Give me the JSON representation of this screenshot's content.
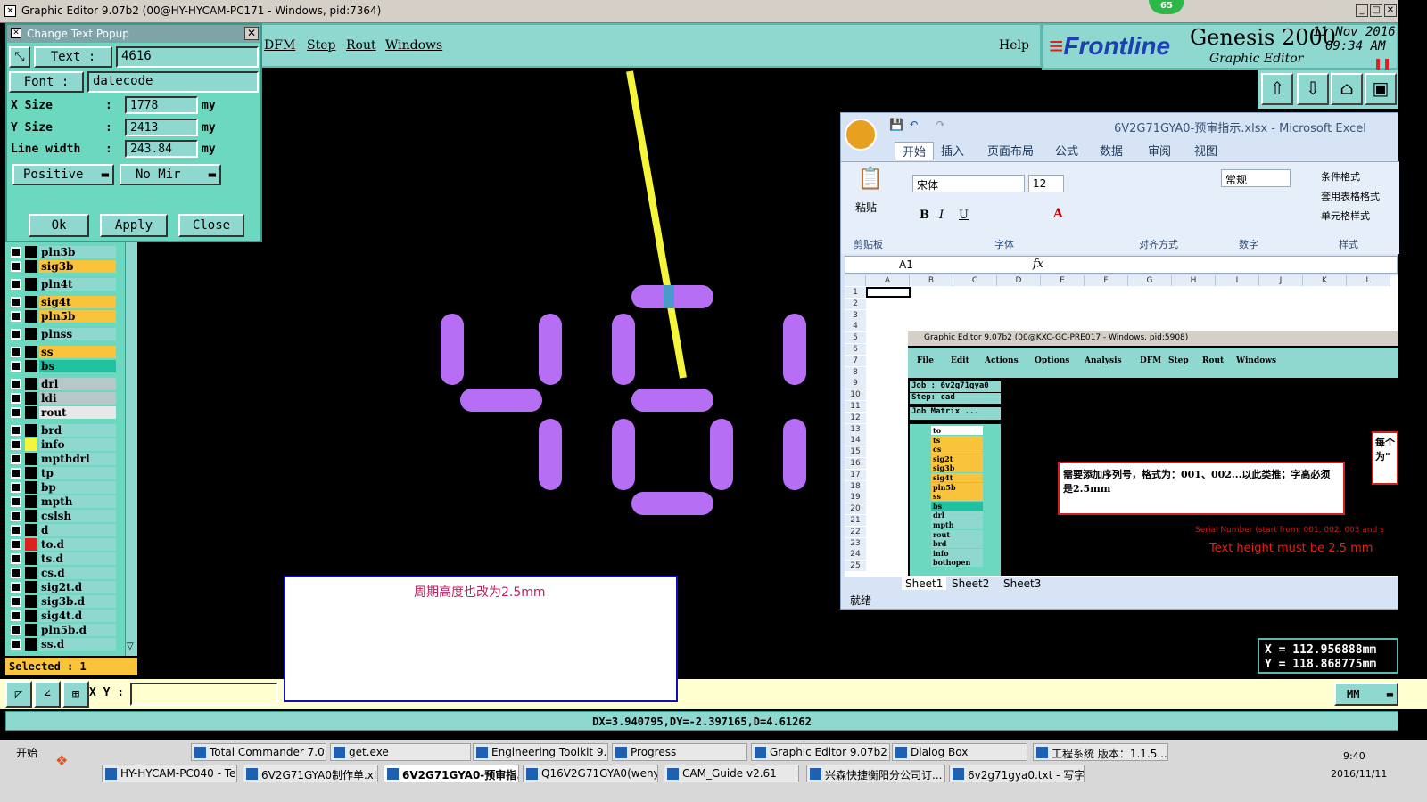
{
  "app": {
    "title": "Graphic Editor 9.07b2 (00@HY-HYCAM-PC171 - Windows, pid:7364)",
    "notif_badge": "65"
  },
  "menu": {
    "items": [
      "DFM",
      "Step",
      "Rout",
      "Windows"
    ],
    "help": "Help"
  },
  "brand": {
    "logo": "Frontline",
    "product": "Genesis 2000",
    "subtitle": "Graphic Editor",
    "date": "11 Nov 2016",
    "time": "09:34 AM"
  },
  "popup": {
    "title": "Change Text Popup",
    "text_btn": "Text :",
    "text_value": "4616",
    "font_btn": "Font :",
    "font_value": "datecode",
    "xsize_label": "X Size",
    "xsize_value": "1778",
    "ysize_label": "Y Size",
    "ysize_value": "2413",
    "linewidth_label": "Line width",
    "linewidth_value": "243.84",
    "unit": "my",
    "colon": ":",
    "polarity": "Positive",
    "mirror": "No Mir",
    "ok": "Ok",
    "apply": "Apply",
    "close": "Close"
  },
  "layers": [
    {
      "name": "pln3b",
      "color": "#8fd8d0"
    },
    {
      "name": "sig3b",
      "color": "#f9c33c"
    },
    {
      "name": "pln4t",
      "color": "#8fd8d0"
    },
    {
      "name": "sig4t",
      "color": "#f9c33c"
    },
    {
      "name": "pln5b",
      "color": "#f9c33c"
    },
    {
      "name": "plnss",
      "color": "#8fd8d0"
    },
    {
      "name": "ss",
      "color": "#f9c33c"
    },
    {
      "name": "bs",
      "color": "#20c0a0"
    },
    {
      "name": "drl",
      "color": "#b8c8c8"
    },
    {
      "name": "ldi",
      "color": "#b8c8c8"
    },
    {
      "name": "rout",
      "color": "#e8e8e8"
    },
    {
      "name": "brd",
      "color": "#8fd8d0"
    },
    {
      "name": "info",
      "color": "#8fd8d0"
    },
    {
      "name": "mpthdrl",
      "color": "#8fd8d0"
    },
    {
      "name": "tp",
      "color": "#8fd8d0"
    },
    {
      "name": "bp",
      "color": "#8fd8d0"
    },
    {
      "name": "mpth",
      "color": "#8fd8d0"
    },
    {
      "name": "cslsh",
      "color": "#8fd8d0"
    },
    {
      "name": "d",
      "color": "#8fd8d0"
    },
    {
      "name": "to.d",
      "color": "#8fd8d0"
    },
    {
      "name": "ts.d",
      "color": "#8fd8d0"
    },
    {
      "name": "cs.d",
      "color": "#8fd8d0"
    },
    {
      "name": "sig2t.d",
      "color": "#8fd8d0"
    },
    {
      "name": "sig3b.d",
      "color": "#8fd8d0"
    },
    {
      "name": "sig4t.d",
      "color": "#8fd8d0"
    },
    {
      "name": "pln5b.d",
      "color": "#8fd8d0"
    },
    {
      "name": "ss.d",
      "color": "#8fd8d0"
    }
  ],
  "selected": "Selected : 1",
  "xy": {
    "label": "X Y :",
    "value": "",
    "units": "MM"
  },
  "status": "DX=3.940795,DY=-2.397165,D=4.61262",
  "coords": {
    "x": "X = 112.956888mm",
    "y": "Y = 118.868775mm"
  },
  "note": {
    "text": "周期高度也改为2.5mm"
  },
  "excel": {
    "title": "6V2G71GYA0-预审指示.xlsx - Microsoft Excel",
    "tabs": [
      "开始",
      "插入",
      "页面布局",
      "公式",
      "数据",
      "审阅",
      "视图"
    ],
    "font": "宋体",
    "size": "12",
    "number_format": "常规",
    "paste": "粘贴",
    "groups": [
      "剪贴板",
      "字体",
      "对齐方式",
      "数字",
      "样式"
    ],
    "styles": [
      "条件格式",
      "套用表格格式",
      "单元格样式"
    ],
    "cell_ref": "A1",
    "fx": "fx",
    "columns": [
      "A",
      "B",
      "C",
      "D",
      "E",
      "F",
      "G",
      "H",
      "I",
      "J",
      "K",
      "L"
    ],
    "rows": [
      "1",
      "2",
      "3",
      "4",
      "5",
      "6",
      "7",
      "8",
      "9",
      "10",
      "11",
      "12",
      "13",
      "14",
      "15",
      "16",
      "17",
      "18",
      "19",
      "20",
      "21",
      "22",
      "23",
      "24",
      "25"
    ],
    "sheets": [
      "Sheet1",
      "Sheet2",
      "Sheet3"
    ],
    "status": "就绪",
    "inner": {
      "title": "Graphic Editor 9.07b2 (00@KXC-GC-PRE017 - Windows, pid:5908)",
      "menu": [
        "File",
        "Edit",
        "Actions",
        "Options",
        "Analysis",
        "DFM",
        "Step",
        "Rout",
        "Windows"
      ],
      "job": "Job : 6v2g71gya0",
      "step": "Step: cad",
      "matrix": "Job Matrix ...",
      "layers": [
        "to",
        "ts",
        "cs",
        "sig2t",
        "sig3b",
        "sig4t",
        "pln5b",
        "ss",
        "bs",
        "drl",
        "mpth",
        "rout",
        "brd",
        "info",
        "bothopen"
      ],
      "note_cn": "需要添加序列号，格式为：001、002...以此类推；字高必须是2.5mm",
      "serial_hint": "Serial Number (start from: 001, 002, 003 and s",
      "height_hint": "Text height must be 2.5 mm",
      "edge_cn1": "每个",
      "edge_cn2": "为\""
    }
  },
  "taskbar": {
    "start": "开始",
    "row1": [
      "Total Commander 7.0 pu...",
      "get.exe",
      "Engineering Toolkit 9.07...",
      "Progress",
      "Graphic Editor 9.07b2 (0...",
      "Dialog Box",
      "工程系统 版本：1.1.5..."
    ],
    "row2": [
      "HY-HYCAM-PC040 - Tea...",
      "6V2G71GYA0制作单.xls ...",
      "6V2G71GYA0-预审指...",
      "Q16V2G71GYA0(wenyh)...",
      "CAM_Guide v2.61",
      "兴森快捷衡阳分公司订...",
      "6v2g71gya0.txt - 写字板"
    ],
    "time": "9:40",
    "date": "2016/11/11"
  }
}
